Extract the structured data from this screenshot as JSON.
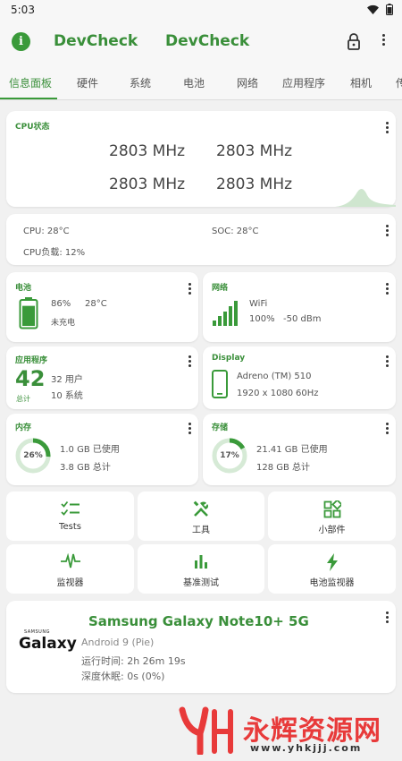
{
  "status_bar": {
    "time": "5:03"
  },
  "app_bar": {
    "title_left": "DevCheck",
    "title_right": "DevCheck"
  },
  "tabs": [
    "信息面板",
    "硬件",
    "系统",
    "电池",
    "网络",
    "应用程序",
    "相机",
    "传"
  ],
  "cpu_card": {
    "title": "CPU状态",
    "frequencies": [
      "2803 MHz",
      "2803 MHz",
      "2803 MHz",
      "2803 MHz"
    ]
  },
  "temps_card": {
    "cpu": "CPU: 28°C",
    "soc": "SOC: 28°C",
    "load": "CPU负载: 12%"
  },
  "battery_card": {
    "title": "电池",
    "percent": "86%",
    "temp": "28°C",
    "status": "未充电",
    "level": 0.86
  },
  "network_card": {
    "title": "网络",
    "type": "WiFi",
    "signal": "100%",
    "dbm": "-50 dBm"
  },
  "apps_card": {
    "title": "应用程序",
    "count": "42",
    "count_label": "总计",
    "user": "32 用户",
    "system": "10 系统"
  },
  "display_card": {
    "title": "Display",
    "gpu": "Adreno (TM) 510",
    "res": "1920 x 1080",
    "hz": "60Hz"
  },
  "memory_card": {
    "title": "内存",
    "percent_label": "26%",
    "used": "1.0 GB 已使用",
    "total": "3.8 GB 总计",
    "fraction": 0.26
  },
  "storage_card": {
    "title": "存储",
    "percent_label": "17%",
    "used": "21.41 GB 已使用",
    "total": "128 GB 总计",
    "fraction": 0.17
  },
  "tools": [
    {
      "label": "Tests",
      "icon": "checklist-icon"
    },
    {
      "label": "工具",
      "icon": "tools-icon"
    },
    {
      "label": "小部件",
      "icon": "widgets-icon"
    },
    {
      "label": "监视器",
      "icon": "pulse-icon"
    },
    {
      "label": "基准测试",
      "icon": "bar-chart-icon"
    },
    {
      "label": "电池监视器",
      "icon": "bolt-icon"
    }
  ],
  "device_card": {
    "brand_top": "SAMSUNG",
    "brand_main": "Galaxy",
    "name": "Samsung Galaxy Note10+ 5G",
    "android": "Android 9 (Pie)",
    "uptime": "运行时间: 2h 26m 19s",
    "deep_sleep": "深度休眠: 0s (0%)"
  },
  "watermark": {
    "text": "永辉资源网",
    "url": "www.yhkjjj.com"
  },
  "colors": {
    "accent": "#3a9a3a",
    "background": "#f1f1f1",
    "card": "#ffffff"
  }
}
